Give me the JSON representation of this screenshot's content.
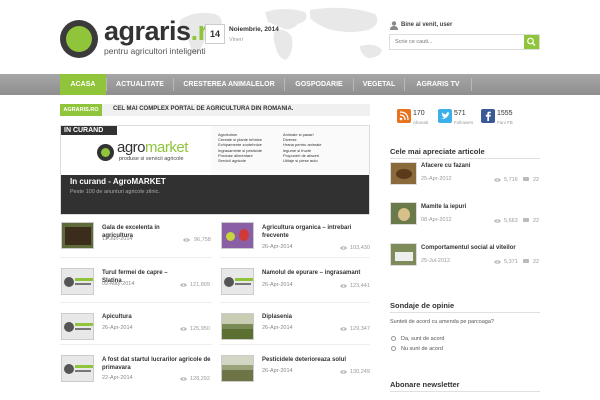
{
  "header": {
    "logo_title_main": "agraris",
    "logo_title_tld": ".ro",
    "logo_subtitle": "pentru agricultori inteligenti",
    "date_number": "14",
    "date_month_year": "Noiembrie, 2014",
    "date_weekday": "Vineri",
    "welcome": "Bine ai venit, user",
    "search_placeholder": "Scrie ce cauti..."
  },
  "nav": {
    "items": [
      {
        "label": "ACASA",
        "active": true
      },
      {
        "label": "ACTUALITATE",
        "active": false
      },
      {
        "label": "CRESTEREA ANIMALELOR",
        "active": false
      },
      {
        "label": "GOSPODARIE",
        "active": false
      },
      {
        "label": "VEGETAL",
        "active": false
      },
      {
        "label": "AGRARIS TV",
        "active": false
      }
    ]
  },
  "ticker": {
    "tag": "AGRARIS.RO",
    "text": "CEL MAI COMPLEX PORTAL DE AGRICULTURA DIN ROMANIA."
  },
  "featured": {
    "badge": "IN CURAND",
    "brand_a": "agro",
    "brand_b": "market",
    "brand_sub": "produse si servicii agricole",
    "categories_left": [
      "Agroturism",
      "Cereale si plante tehnice",
      "Echipamente zootehnice",
      "Ingrasaminte si pesticide",
      "Produse alimentare",
      "Servicii agricole"
    ],
    "categories_right": [
      "Animale si pasari",
      "Diverse",
      "Hrana pentru animale",
      "legume si fructe",
      "Propuneri de afaceri",
      "Utilaje si piese auto"
    ],
    "title": "In curand - AgroMARKET",
    "description": "Peste 100 de anunturi agricole zilnic."
  },
  "posts": [
    {
      "title": "Gala de excelenta in agricultura",
      "date": "11-Jun-2014",
      "views": "96,758"
    },
    {
      "title": "Agricultura organica – intrebari frecvente",
      "date": "26-Apr-2014",
      "views": "103,430"
    },
    {
      "title": "Turul fermei de capre – Slatina",
      "date": "09-May-2014",
      "views": "121,809"
    },
    {
      "title": "Namolul de epurare – ingrasamant",
      "date": "26-Apr-2014",
      "views": "123,441"
    },
    {
      "title": "Apicultura",
      "date": "26-Apr-2014",
      "views": "125,950"
    },
    {
      "title": "Diplasenia",
      "date": "26-Apr-2014",
      "views": "129,347"
    },
    {
      "title": "A fost dat startul lucrarilor agricole de primavara",
      "date": "22-Apr-2014",
      "views": "128,292"
    },
    {
      "title": "Pesticidele deterioreaza solul",
      "date": "26-Apr-2014",
      "views": "130,249"
    }
  ],
  "social": [
    {
      "count": "170",
      "label": "Abonati",
      "color": "#e8731f",
      "icon": "rss-icon"
    },
    {
      "count": "571",
      "label": "Followers",
      "color": "#3cb0e8",
      "icon": "twitter-icon"
    },
    {
      "count": "1555",
      "label": "Fani FB",
      "color": "#3b5998",
      "icon": "facebook-icon"
    }
  ],
  "liked": {
    "heading": "Cele mai apreciate articole",
    "items": [
      {
        "title": "Afacere cu fazani",
        "date": "25-Apr-2012",
        "views": "5,716",
        "comments": "22"
      },
      {
        "title": "Mamite la iepuri",
        "date": "08-Apr-2012",
        "views": "5,663",
        "comments": "22"
      },
      {
        "title": "Comportamentul social al viteilor",
        "date": "25-Jul-2012",
        "views": "5,371",
        "comments": "22"
      }
    ]
  },
  "poll": {
    "heading": "Sondaje de opinie",
    "question": "Sunteti de acord cu amenda pe parcoaga?",
    "options": [
      "Da, sunt de acord",
      "Nu sunt de acord"
    ]
  },
  "newsletter": {
    "heading": "Abonare newsletter"
  }
}
